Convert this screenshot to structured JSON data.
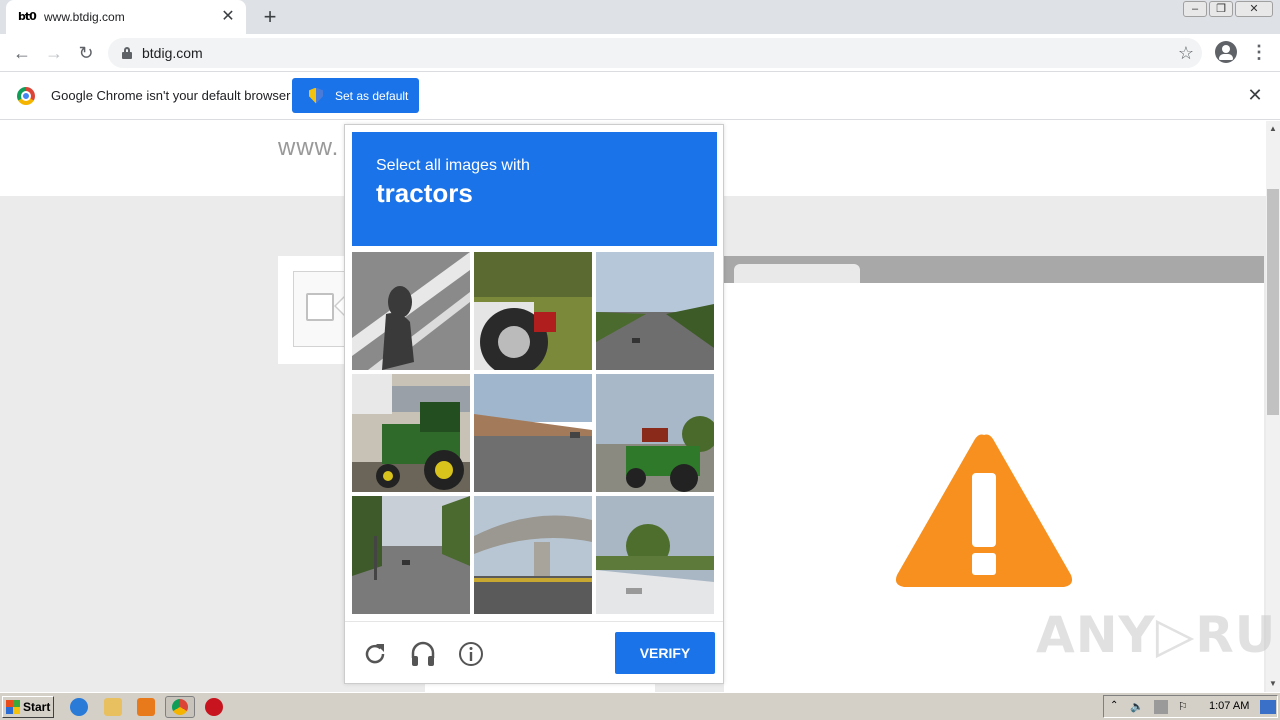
{
  "browser": {
    "tab_title": "www.btdig.com",
    "tab_favicon_text": "bt0",
    "url": "btdig.com",
    "infobar_message": "Google Chrome isn't your default browser",
    "infobar_button": "Set as default"
  },
  "page": {
    "url_text": "www.",
    "watermark": "ANY RUN"
  },
  "captcha": {
    "instruction": "Select all images with",
    "target": "tractors",
    "verify_label": "VERIFY",
    "tiles": [
      "road-shadow",
      "tractor-wheel",
      "street-houses",
      "green-tractor",
      "warehouse-lot",
      "tractor-field",
      "city-street",
      "overpass",
      "tree-rooftop"
    ]
  },
  "taskbar": {
    "start_label": "Start",
    "clock": "1:07 AM"
  },
  "colors": {
    "captcha_blue": "#1a73e8",
    "warning_orange": "#f7901e"
  }
}
